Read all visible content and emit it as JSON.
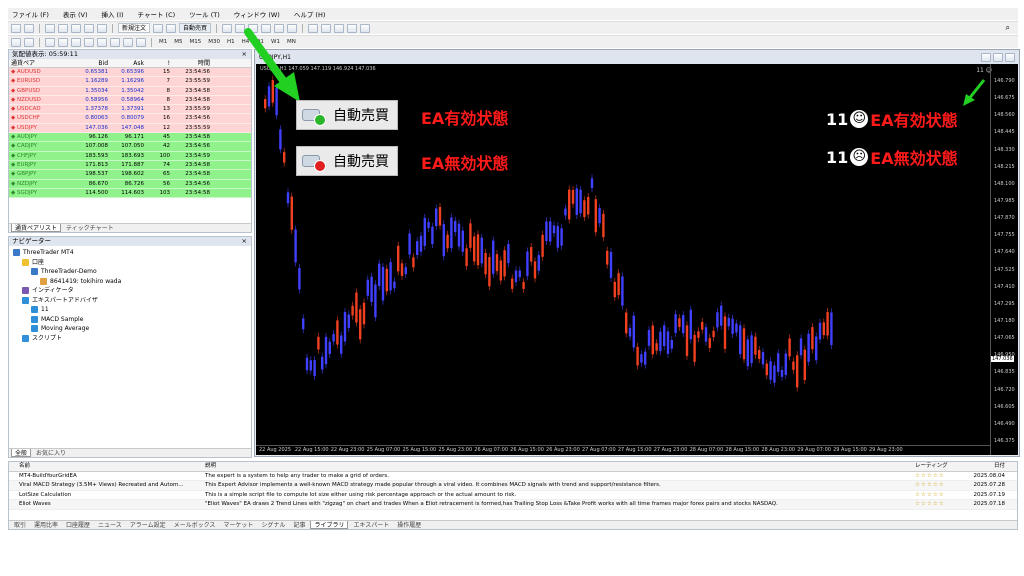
{
  "menu": [
    "ファイル (F)",
    "表示 (V)",
    "挿入 (I)",
    "チャート (C)",
    "ツール (T)",
    "ウィンドウ (W)",
    "ヘルプ (H)"
  ],
  "toolbar": {
    "new_order": "新規注文",
    "auto_trade": "自動売買",
    "timeframes": [
      "M1",
      "M5",
      "M15",
      "M30",
      "H1",
      "H4",
      "D1",
      "W1",
      "MN"
    ]
  },
  "market_watch": {
    "title": "気配値表示: 05:59:11",
    "headers": {
      "pair": "通貨ペア",
      "bid": "Bid",
      "ask": "Ask",
      "spread": "!",
      "time": "時間"
    },
    "rows": [
      {
        "pair": "AUDUSD",
        "bid": "0.65381",
        "ask": "0.65396",
        "spread": "15",
        "time": "23:54:56",
        "color": "red"
      },
      {
        "pair": "EURUSD",
        "bid": "1.16289",
        "ask": "1.16296",
        "spread": "7",
        "time": "23:55:59",
        "color": "red"
      },
      {
        "pair": "GBPUSD",
        "bid": "1.35034",
        "ask": "1.35042",
        "spread": "8",
        "time": "23:54:58",
        "color": "red"
      },
      {
        "pair": "NZDUSD",
        "bid": "0.58956",
        "ask": "0.58964",
        "spread": "8",
        "time": "23:54:58",
        "color": "red"
      },
      {
        "pair": "USDCAD",
        "bid": "1.37378",
        "ask": "1.37391",
        "spread": "13",
        "time": "23:55:59",
        "color": "red"
      },
      {
        "pair": "USDCHF",
        "bid": "0.80063",
        "ask": "0.80079",
        "spread": "16",
        "time": "23:54:56",
        "color": "red"
      },
      {
        "pair": "USDJPY",
        "bid": "147.036",
        "ask": "147.048",
        "spread": "12",
        "time": "23:55:59",
        "color": "red"
      },
      {
        "pair": "AUDJPY",
        "bid": "96.126",
        "ask": "96.171",
        "spread": "45",
        "time": "23:54:58",
        "color": "grn"
      },
      {
        "pair": "CADJPY",
        "bid": "107.008",
        "ask": "107.050",
        "spread": "42",
        "time": "23:54:56",
        "color": "grn"
      },
      {
        "pair": "CHFJPY",
        "bid": "183.593",
        "ask": "183.693",
        "spread": "100",
        "time": "23:54:59",
        "color": "grn"
      },
      {
        "pair": "EURJPY",
        "bid": "171.813",
        "ask": "171.887",
        "spread": "74",
        "time": "23:54:58",
        "color": "grn"
      },
      {
        "pair": "GBPJPY",
        "bid": "198.537",
        "ask": "198.602",
        "spread": "65",
        "time": "23:54:58",
        "color": "grn"
      },
      {
        "pair": "NZDJPY",
        "bid": "86.670",
        "ask": "86.726",
        "spread": "56",
        "time": "23:54:56",
        "color": "grn"
      },
      {
        "pair": "SGDJPY",
        "bid": "114.500",
        "ask": "114.603",
        "spread": "103",
        "time": "23:54:58",
        "color": "grn"
      }
    ],
    "tabs": [
      "通貨ペアリスト",
      "ティックチャート"
    ]
  },
  "navigator": {
    "title": "ナビゲーター",
    "items": [
      {
        "label": "ThreeTrader MT4",
        "indent": 0
      },
      {
        "label": "口座",
        "indent": 1
      },
      {
        "label": "ThreeTrader-Demo",
        "indent": 2
      },
      {
        "label": "8641419: tokihiro wada",
        "indent": 3
      },
      {
        "label": "インディケータ",
        "indent": 1
      },
      {
        "label": "エキスパートアドバイザ",
        "indent": 1
      },
      {
        "label": "11",
        "indent": 2
      },
      {
        "label": "MACD Sample",
        "indent": 2
      },
      {
        "label": "Moving Average",
        "indent": 2
      },
      {
        "label": "スクリプト",
        "indent": 1
      }
    ],
    "tabs": [
      "全般",
      "お気に入り"
    ]
  },
  "chart": {
    "title": "USDJPY,H1",
    "ohlc_text": "147.059 147.119 146.924 147.036",
    "ea_label": "11",
    "current_price": "147.036",
    "price_ticks": [
      "146.790",
      "146.675",
      "148.560",
      "148.445",
      "148.330",
      "148.215",
      "148.100",
      "147.985",
      "147.870",
      "147.755",
      "147.640",
      "147.525",
      "147.410",
      "147.295",
      "147.180",
      "147.065",
      "146.950",
      "146.835",
      "146.720",
      "146.605",
      "146.490",
      "146.375"
    ],
    "time_ticks": [
      "22 Aug 2025",
      "22 Aug 15:00",
      "22 Aug 23:00",
      "25 Aug 07:00",
      "25 Aug 15:00",
      "25 Aug 23:00",
      "26 Aug 07:00",
      "26 Aug 15:00",
      "26 Aug 23:00",
      "27 Aug 07:00",
      "27 Aug 15:00",
      "27 Aug 23:00",
      "28 Aug 07:00",
      "28 Aug 15:00",
      "28 Aug 23:00",
      "29 Aug 07:00",
      "29 Aug 15:00",
      "29 Aug 23:00"
    ]
  },
  "annotations": {
    "auto_trade_label": "自動売買",
    "ea_enabled": "EA有効状態",
    "ea_disabled": "EA無効状態",
    "ea_number": "11"
  },
  "library": {
    "headers": {
      "name": "名前",
      "desc": "説明",
      "rating": "レーティング",
      "date": "日付"
    },
    "rows": [
      {
        "name": "MT4-BuildYourGridEA",
        "desc": "The expert is a system to help any trader to make a grid of orders.",
        "rating": "☆☆☆☆☆",
        "date": "2025.08.04"
      },
      {
        "name": "Viral MACD Strategy (3.5M+ Views)  Recreated and Autom...",
        "desc": "This Expert Advisor implements a well-known MACD strategy made popular through a viral video. It combines MACD signals with trend and support/resistance filters.",
        "rating": "☆☆☆☆☆",
        "date": "2025.07.28"
      },
      {
        "name": "LotSize Calculation",
        "desc": "This is a simple script file to compute lot size either using risk percentage approach or the actual amount to risk.",
        "rating": "☆☆☆☆☆",
        "date": "2025.07.19"
      },
      {
        "name": "Eliot Waves",
        "desc": "\"Eliot Waves\" EA draws 2 Trend Lines with \"zigzag\" on chart and trades When a Eliot retracement is formed,has Trailing Stop Loss &Take Profit works with all time frames major forex pairs and stocks NASDAQ.",
        "rating": "☆☆☆☆☆",
        "date": "2025.07.18"
      }
    ]
  },
  "terminal_tabs": [
    "取引",
    "運用比率",
    "口座履歴",
    "ニュース",
    "アラーム設定",
    "メールボックス",
    "マーケット",
    "シグナル",
    "記事",
    "ライブラリ",
    "エキスパート",
    "操作履歴"
  ],
  "colors": {
    "bull": "#f04020",
    "bear": "#4040ff",
    "arrow": "#33dd33",
    "annotation": "#ff1a1a"
  }
}
